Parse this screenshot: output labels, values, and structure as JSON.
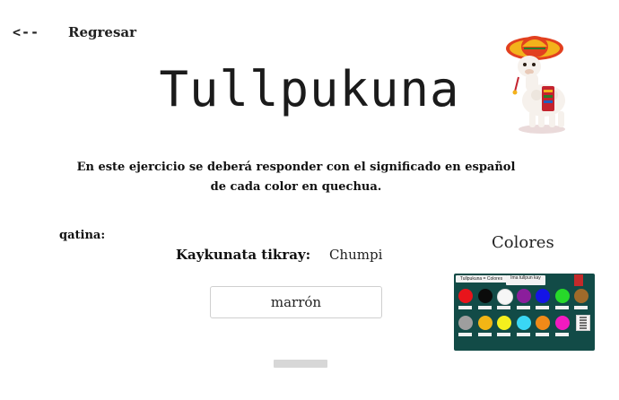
{
  "nav": {
    "back_arrow": "<--",
    "back_label": "Regresar"
  },
  "title": "Tullpukuna",
  "instructions": "En este ejercicio se deberá responder con el significado en español de cada color en quechua.",
  "word": {
    "label": "qatina:",
    "answer_label": "Kaykunata tikray:",
    "answer_value": "Chumpi",
    "input_value": "marrón"
  },
  "colors_panel": {
    "title": "Colores",
    "card_title": "Tullpukuna = Colores",
    "card_subtitle": "Ima tullpun kay",
    "swatches_row1": [
      "#e8141b",
      "#0b0b0b",
      "#f6f6f6",
      "#8b1e9c",
      "#1414e6",
      "#27d82a",
      "#a06a2a"
    ],
    "swatches_row2": [
      "#9e9e9e",
      "#f2b515",
      "#f4ef1e",
      "#3ad7f4",
      "#f08a18",
      "#f11ac0"
    ]
  },
  "colors": {
    "accent": "#124b47",
    "bar": "#d7d7d7"
  }
}
